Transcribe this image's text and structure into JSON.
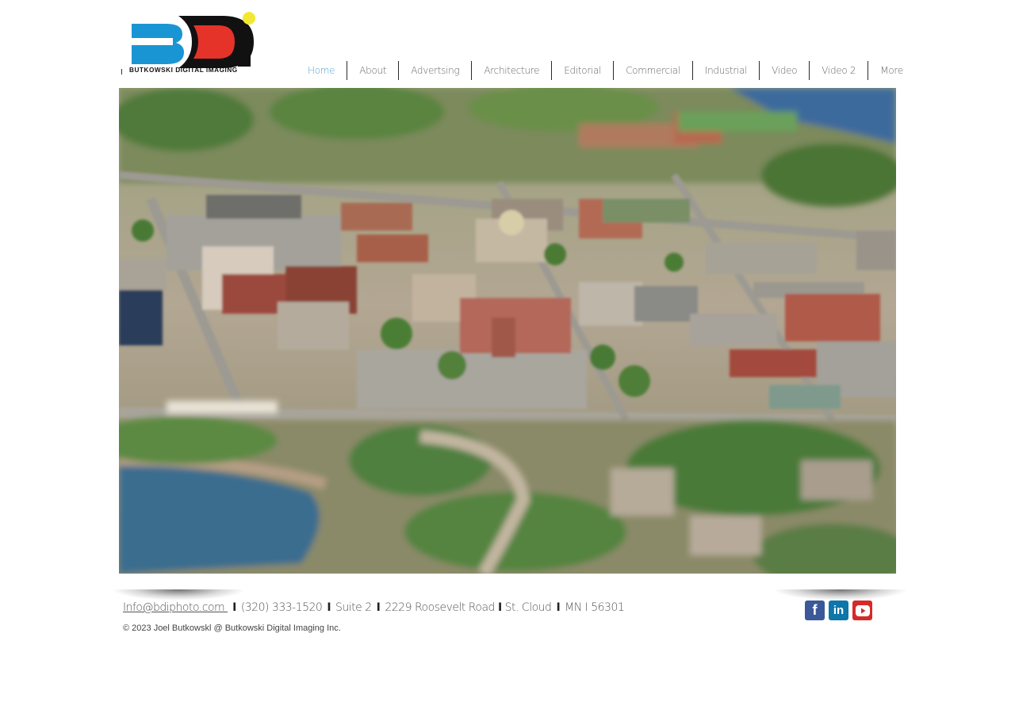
{
  "logo": {
    "company_name": "BUTKOWSKI DIGITAL IMAGING",
    "mark": "BDi"
  },
  "nav": {
    "items": [
      {
        "label": "Home",
        "active": true
      },
      {
        "label": "About"
      },
      {
        "label": "Advertsing"
      },
      {
        "label": "Architecture"
      },
      {
        "label": "Editorial"
      },
      {
        "label": "Commercial"
      },
      {
        "label": "Industrial"
      },
      {
        "label": "Video"
      },
      {
        "label": "Video 2"
      },
      {
        "label": "More"
      }
    ]
  },
  "footer": {
    "email": "Info@bdiphoto.com ",
    "phone": "(320) 333-1520",
    "suite": "Suite 2",
    "street": "2229 Roosevelt Road",
    "city": "St. Cloud",
    "state_zip": "MN I 56301",
    "separator": "I",
    "copyright": "© 2023 Joel Butkowskl @ Butkowski Digital Imaging Inc."
  },
  "social": {
    "facebook": "f",
    "linkedin": "in"
  },
  "colors": {
    "accent": "#4fa3cc",
    "logo_blue": "#1a95d4",
    "logo_red": "#e5332a",
    "logo_yellow": "#f2e832"
  }
}
